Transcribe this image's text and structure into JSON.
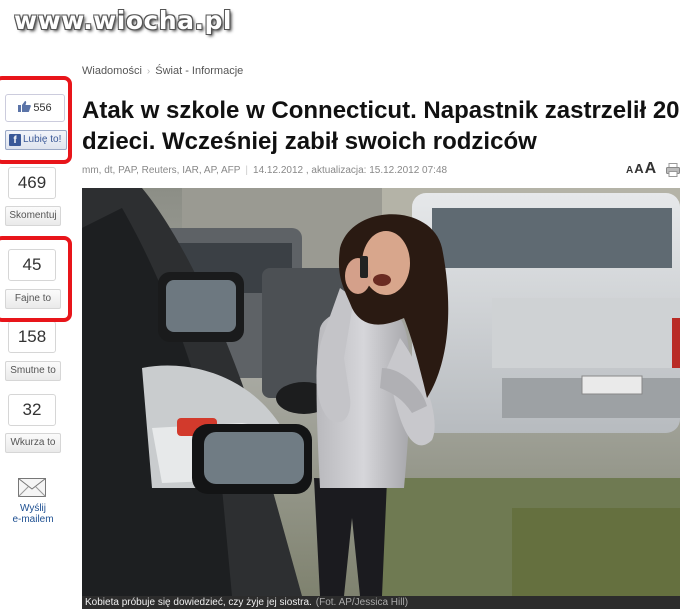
{
  "watermark": "www.wiocha.pl",
  "social": {
    "fb_count": "556",
    "fb_like_label": "Lubię to!",
    "counters": [
      {
        "value": "469",
        "label": "Skomentuj"
      },
      {
        "value": "45",
        "label": "Fajne to"
      },
      {
        "value": "158",
        "label": "Smutne to"
      },
      {
        "value": "32",
        "label": "Wkurza to"
      }
    ],
    "email_label_line1": "Wyślij",
    "email_label_line2": "e-mailem"
  },
  "breadcrumb": {
    "items": [
      "Wiadomości",
      "Świat - Informacje"
    ]
  },
  "article": {
    "title": "Atak w szkole w Connecticut. Napastnik zastrzelił 20 dzieci. Wcześniej zabił swoich rodziców",
    "sources": "mm, dt, PAP, Reuters, IAR, AP, AFP",
    "date": "14.12.2012",
    "update": ", aktualizacja: 15.12.2012 07:48",
    "font_controls": [
      "A",
      "A",
      "A"
    ],
    "caption": "Kobieta próbuje się dowiedzieć, czy żyje jej siostra.",
    "caption_credit": "(Fot. AP/Jessica Hill)"
  },
  "colors": {
    "highlight_red": "#e8151a",
    "facebook_blue": "#3b5998",
    "caption_bg": "#2c2c2c"
  },
  "icons": {
    "thumb": "thumbs-up-icon",
    "facebook": "facebook-icon",
    "envelope": "envelope-icon",
    "print": "print-icon"
  }
}
